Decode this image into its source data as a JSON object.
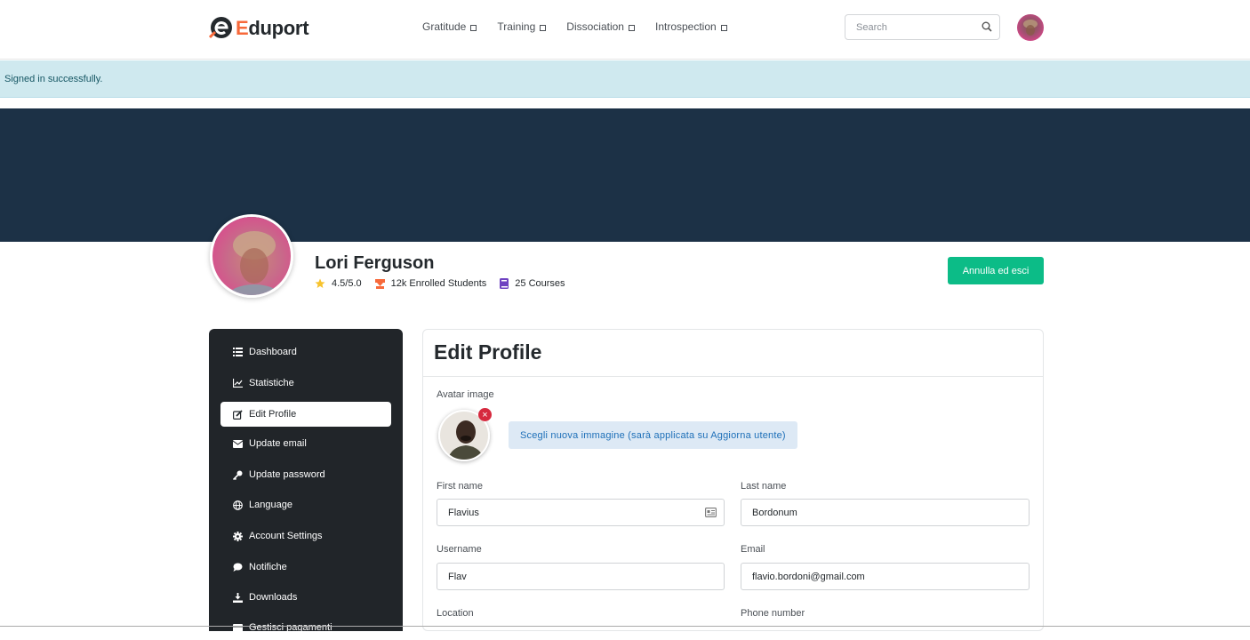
{
  "brand": {
    "logo_text": "Eduport",
    "accent": "#f7693a"
  },
  "nav": {
    "items": [
      {
        "label": "Gratitude"
      },
      {
        "label": "Training"
      },
      {
        "label": "Dissociation"
      },
      {
        "label": "Introspection"
      }
    ],
    "search_placeholder": "Search"
  },
  "alert": {
    "message": "Signed in successfully."
  },
  "profile": {
    "name": "Lori Ferguson",
    "rating": "4.5/5.0",
    "students": "12k Enrolled Students",
    "courses": "25 Courses",
    "exit_button": "Annulla ed esci"
  },
  "sidebar": {
    "items": [
      {
        "label": "Dashboard",
        "icon": "list-icon"
      },
      {
        "label": "Statistiche",
        "icon": "chart-line-icon"
      },
      {
        "label": "Edit Profile",
        "icon": "edit-icon",
        "active": true
      },
      {
        "label": "Update email",
        "icon": "envelope-icon"
      },
      {
        "label": "Update password",
        "icon": "key-icon"
      },
      {
        "label": "Language",
        "icon": "globe-icon"
      },
      {
        "label": "Account Settings",
        "icon": "gear-icon"
      },
      {
        "label": "Notifiche",
        "icon": "chat-icon"
      },
      {
        "label": "Downloads",
        "icon": "download-icon"
      },
      {
        "label": "Gestisci pagamenti",
        "icon": "credit-card-icon"
      }
    ]
  },
  "edit_profile": {
    "title": "Edit Profile",
    "avatar_label": "Avatar image",
    "choose_image": "Scegli nuova immagine (sarà applicata su Aggiorna utente)",
    "first_name_label": "First name",
    "first_name": "Flavius",
    "last_name_label": "Last name",
    "last_name": "Bordonum",
    "username_label": "Username",
    "username": "Flav",
    "email_label": "Email",
    "email": "flavio.bordoni@gmail.com",
    "location_label": "Location",
    "phone_label": "Phone number"
  },
  "colors": {
    "banner": "#1c3146",
    "primary_button": "#0cbc87",
    "sidebar_bg": "#212529",
    "alert_bg": "#cfe9ef"
  }
}
